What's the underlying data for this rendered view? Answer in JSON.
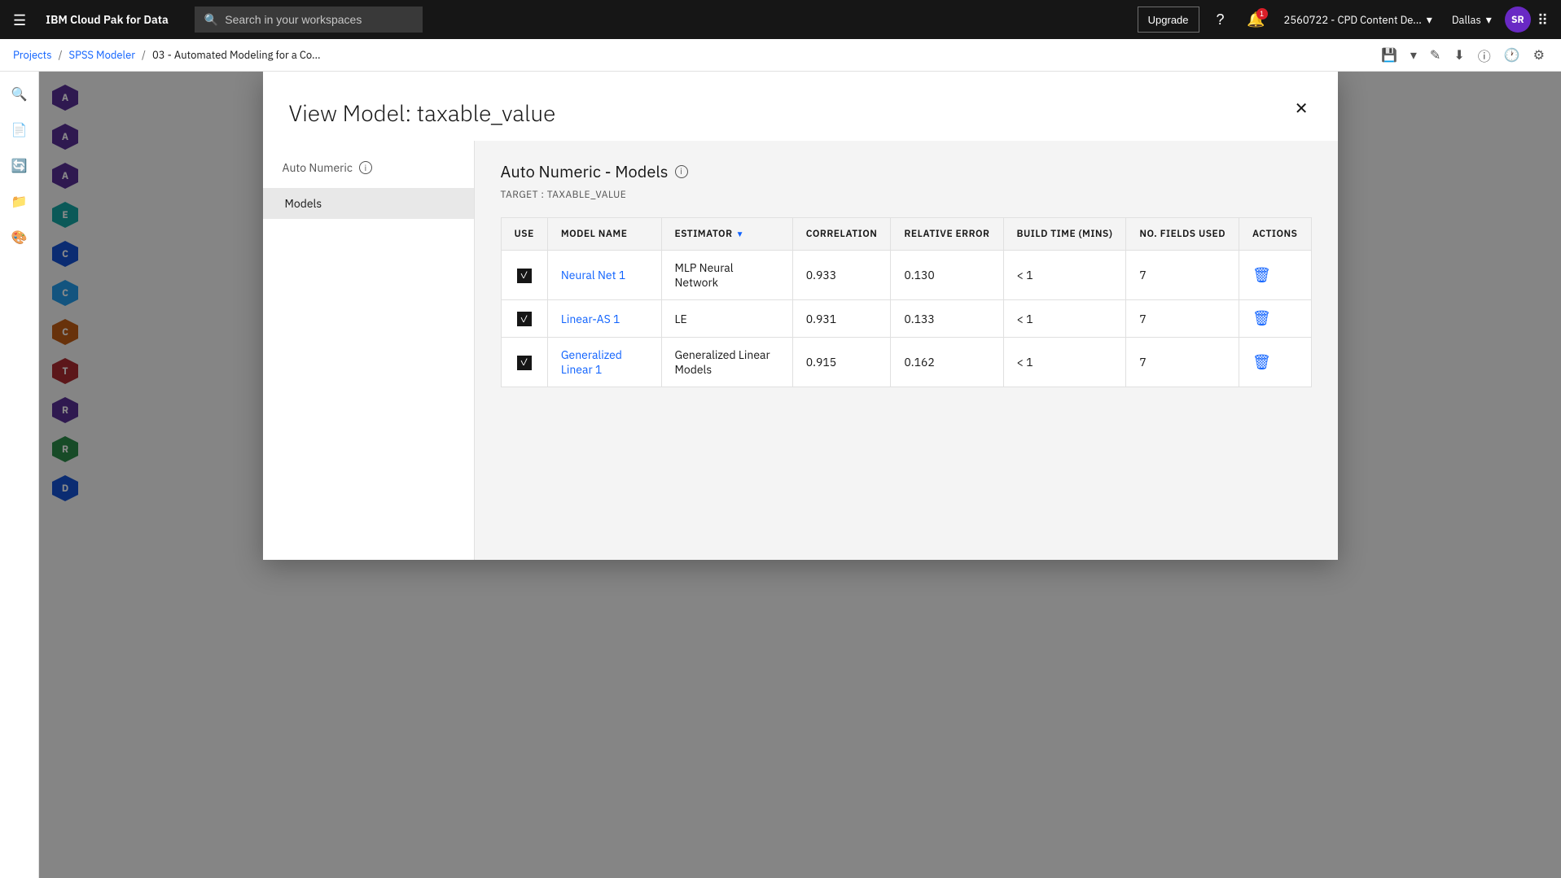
{
  "topbar": {
    "menu_icon": "☰",
    "logo": "IBM Cloud Pak for Data",
    "search_placeholder": "Search in your workspaces",
    "upgrade_label": "Upgrade",
    "help_icon": "?",
    "notification_count": "1",
    "account_name": "2560722 - CPD Content De...",
    "region": "Dallas",
    "avatar_initials": "SR",
    "grid_icon": "⠿"
  },
  "breadcrumb": {
    "items": [
      "Projects",
      "SPSS Modeler",
      "03 - Automated Modeling for a Co..."
    ]
  },
  "modal": {
    "title": "View Model: taxable_value",
    "close_icon": "✕",
    "sidebar": {
      "section_title": "Auto Numeric",
      "nav_items": [
        {
          "label": "Models",
          "active": true
        }
      ]
    },
    "content": {
      "section_title": "Auto Numeric - Models",
      "target_label": "TARGET : TAXABLE_VALUE",
      "table": {
        "columns": [
          {
            "key": "use",
            "label": "USE"
          },
          {
            "key": "model_name",
            "label": "MODEL NAME"
          },
          {
            "key": "estimator",
            "label": "ESTIMATOR",
            "sortable": true
          },
          {
            "key": "correlation",
            "label": "CORRELATION"
          },
          {
            "key": "relative_error",
            "label": "RELATIVE ERROR"
          },
          {
            "key": "build_time",
            "label": "BUILD TIME (MINS)"
          },
          {
            "key": "no_fields",
            "label": "NO. FIELDS USED"
          },
          {
            "key": "actions",
            "label": "ACTIONS"
          }
        ],
        "rows": [
          {
            "checked": true,
            "model_name": "Neural Net 1",
            "estimator": "MLP Neural Network",
            "correlation": "0.933",
            "relative_error": "0.130",
            "build_time": "< 1",
            "no_fields": "7"
          },
          {
            "checked": true,
            "model_name": "Linear-AS 1",
            "estimator": "LE",
            "correlation": "0.931",
            "relative_error": "0.133",
            "build_time": "< 1",
            "no_fields": "7"
          },
          {
            "checked": true,
            "model_name": "Generalized Linear 1",
            "estimator": "Generalized Linear Models",
            "correlation": "0.915",
            "relative_error": "0.162",
            "build_time": "< 1",
            "no_fields": "7"
          }
        ]
      }
    }
  },
  "sidebar_icons": [
    "☰",
    "🔍",
    "📄",
    "🔄",
    "📁",
    "🗂"
  ],
  "node_items": [
    {
      "label": "A",
      "color": "purple"
    },
    {
      "label": "A",
      "color": "purple"
    },
    {
      "label": "A",
      "color": "purple"
    },
    {
      "label": "E",
      "color": "teal"
    },
    {
      "label": "C",
      "color": "blue"
    },
    {
      "label": "C",
      "color": "cyan"
    },
    {
      "label": "C",
      "color": "orange"
    },
    {
      "label": "T",
      "color": "red"
    },
    {
      "label": "R",
      "color": "purple"
    },
    {
      "label": "R",
      "color": "green"
    },
    {
      "label": "D",
      "color": "blue"
    }
  ],
  "colors": {
    "accent": "#0f62fe",
    "brand": "#161616",
    "sidebar_active": "#e8e8e8"
  }
}
